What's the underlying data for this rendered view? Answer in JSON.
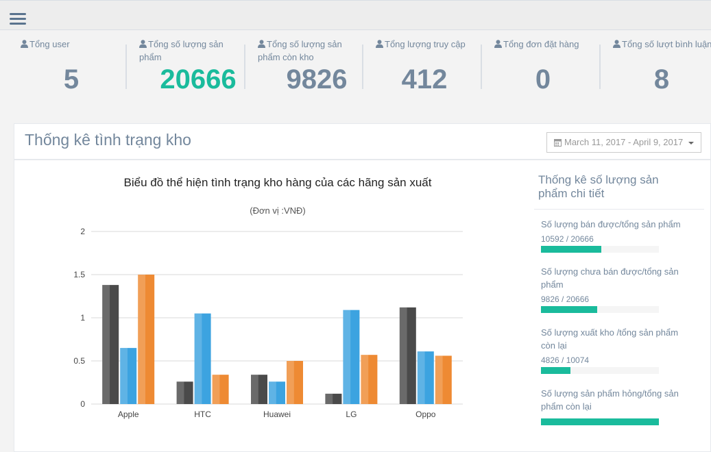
{
  "stats": [
    {
      "label": "Tổng user",
      "value": "5",
      "highlight": false
    },
    {
      "label": "Tổng số lượng sản phẩm",
      "value": "20666",
      "highlight": true
    },
    {
      "label": "Tổng số lượng sản phẩm còn kho",
      "value": "9826",
      "highlight": false
    },
    {
      "label": "Tổng lượng truy cập",
      "value": "412",
      "highlight": false
    },
    {
      "label": "Tổng đơn đặt hàng",
      "value": "0",
      "highlight": false
    },
    {
      "label": "Tổng số lượt bình luận",
      "value": "8",
      "highlight": false
    }
  ],
  "panel": {
    "title": "Thống kê tình trạng kho",
    "date_range": "March 11, 2017 - April 9, 2017"
  },
  "sidebar": {
    "title": "Thống kê số lượng sản phẩm chi tiết",
    "widgets": [
      {
        "label": "Số lượng bán được/tổng sản phẩm",
        "value": "10592 / 20666",
        "fraction": 0.5125
      },
      {
        "label": "Số lượng chưa bán được/tổng sản phẩm",
        "value": "9826 / 20666",
        "fraction": 0.4755
      },
      {
        "label": "Số lượng xuất kho /tổng sản phẩm còn lại",
        "value": "4826 / 10074",
        "fraction": 0.25
      },
      {
        "label": "Số lượng sản phẩm hỏng/tổng sản phẩm còn lại",
        "value": "",
        "fraction": 1.0
      }
    ]
  },
  "colors": {
    "accent": "#1abb9c",
    "text": "#73879c",
    "series": [
      "#4a4a4a",
      "#3ca3e0",
      "#ee8a33"
    ]
  },
  "chart_data": {
    "type": "bar",
    "title": "Biểu đồ thể hiện tình trạng kho hàng của các hãng sản xuất",
    "subtitle": "(Đơn vị :VNĐ)",
    "categories": [
      "Apple",
      "HTC",
      "Huawei",
      "LG",
      "Oppo"
    ],
    "series": [
      {
        "values": [
          1.38,
          0.26,
          0.34,
          0.12,
          1.12
        ]
      },
      {
        "values": [
          0.65,
          1.05,
          0.26,
          1.09,
          0.61
        ]
      },
      {
        "values": [
          1.5,
          0.34,
          0.5,
          0.57,
          0.56
        ]
      }
    ],
    "y_ticks": [
      "0",
      "0.5",
      "1",
      "1.5",
      "2"
    ],
    "ylim": [
      0,
      2
    ],
    "grid": true,
    "legend": "none"
  }
}
